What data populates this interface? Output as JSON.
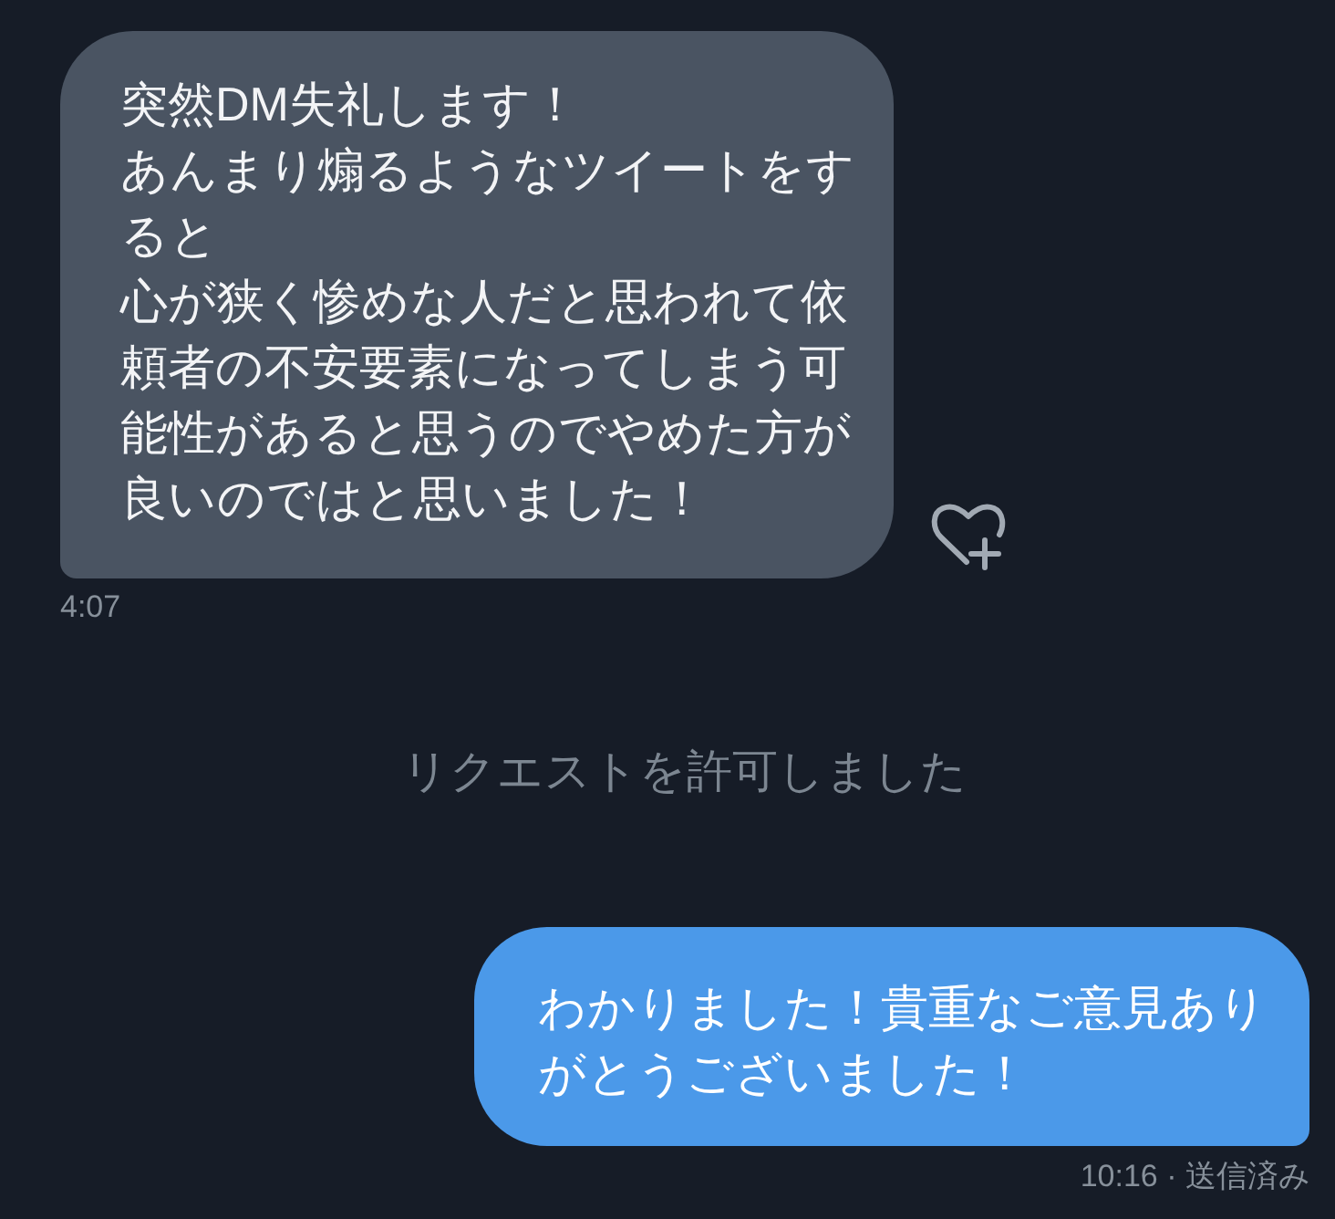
{
  "conversation": [
    {
      "kind": "received",
      "paragraphs": [
        "突然DM失礼します！",
        "あんまり煽るようなツイートをすると",
        "心が狭く惨めな人だと思われて依頼者の不安要素になってしまう可能性があると思うのでやめた方が良いのではと思いました！"
      ],
      "meta": "4:07"
    },
    {
      "kind": "notice",
      "text": "リクエストを許可しました"
    },
    {
      "kind": "sent",
      "paragraphs": [
        "わかりました！貴重なご意見ありがとうございました！"
      ],
      "meta": "10:16 · 送信済み"
    }
  ]
}
